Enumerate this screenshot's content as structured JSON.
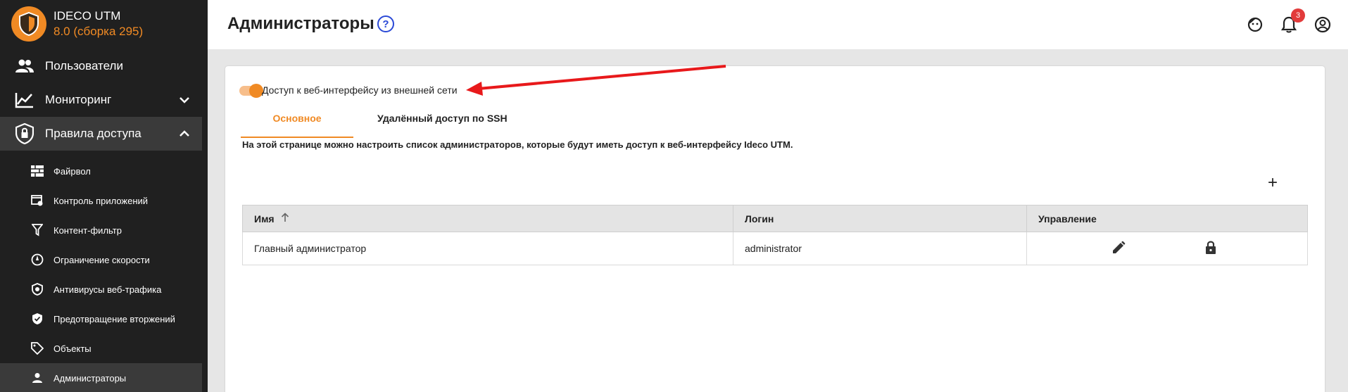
{
  "brand": {
    "title": "IDECO UTM",
    "version": "8.0 (сборка 295)"
  },
  "sidebar": {
    "items": [
      {
        "label": "Пользователи",
        "icon": "users-icon"
      },
      {
        "label": "Мониторинг",
        "icon": "chart-line-icon"
      },
      {
        "label": "Правила доступа",
        "icon": "shield-lock-icon"
      }
    ],
    "subitems": [
      {
        "label": "Файрвол",
        "icon": "firewall-icon"
      },
      {
        "label": "Контроль приложений",
        "icon": "app-control-icon"
      },
      {
        "label": "Контент-фильтр",
        "icon": "filter-icon"
      },
      {
        "label": "Ограничение скорости",
        "icon": "speed-limit-icon"
      },
      {
        "label": "Антивирусы веб-трафика",
        "icon": "antivirus-icon"
      },
      {
        "label": "Предотвращение вторжений",
        "icon": "intrusion-shield-icon"
      },
      {
        "label": "Объекты",
        "icon": "tag-icon"
      },
      {
        "label": "Администраторы",
        "icon": "admin-icon"
      }
    ]
  },
  "header": {
    "title": "Администраторы",
    "help_symbol": "?",
    "notification_count": "3"
  },
  "card": {
    "toggle_label": "Доступ к веб-интерфейсу из внешней сети",
    "tabs": [
      "Основное",
      "Удалённый доступ по SSH"
    ],
    "description": "На этой странице можно настроить список администраторов, которые будут иметь доступ к веб-интерфейсу Ideco UTM.",
    "add_symbol": "+"
  },
  "table": {
    "columns": [
      "Имя",
      "Логин",
      "Управление"
    ],
    "rows": [
      {
        "name": "Главный администратор",
        "login": "administrator"
      }
    ]
  },
  "colors": {
    "accent": "#f08a24",
    "sidebar_bg": "#202020",
    "annotation_arrow": "#e8191b"
  }
}
